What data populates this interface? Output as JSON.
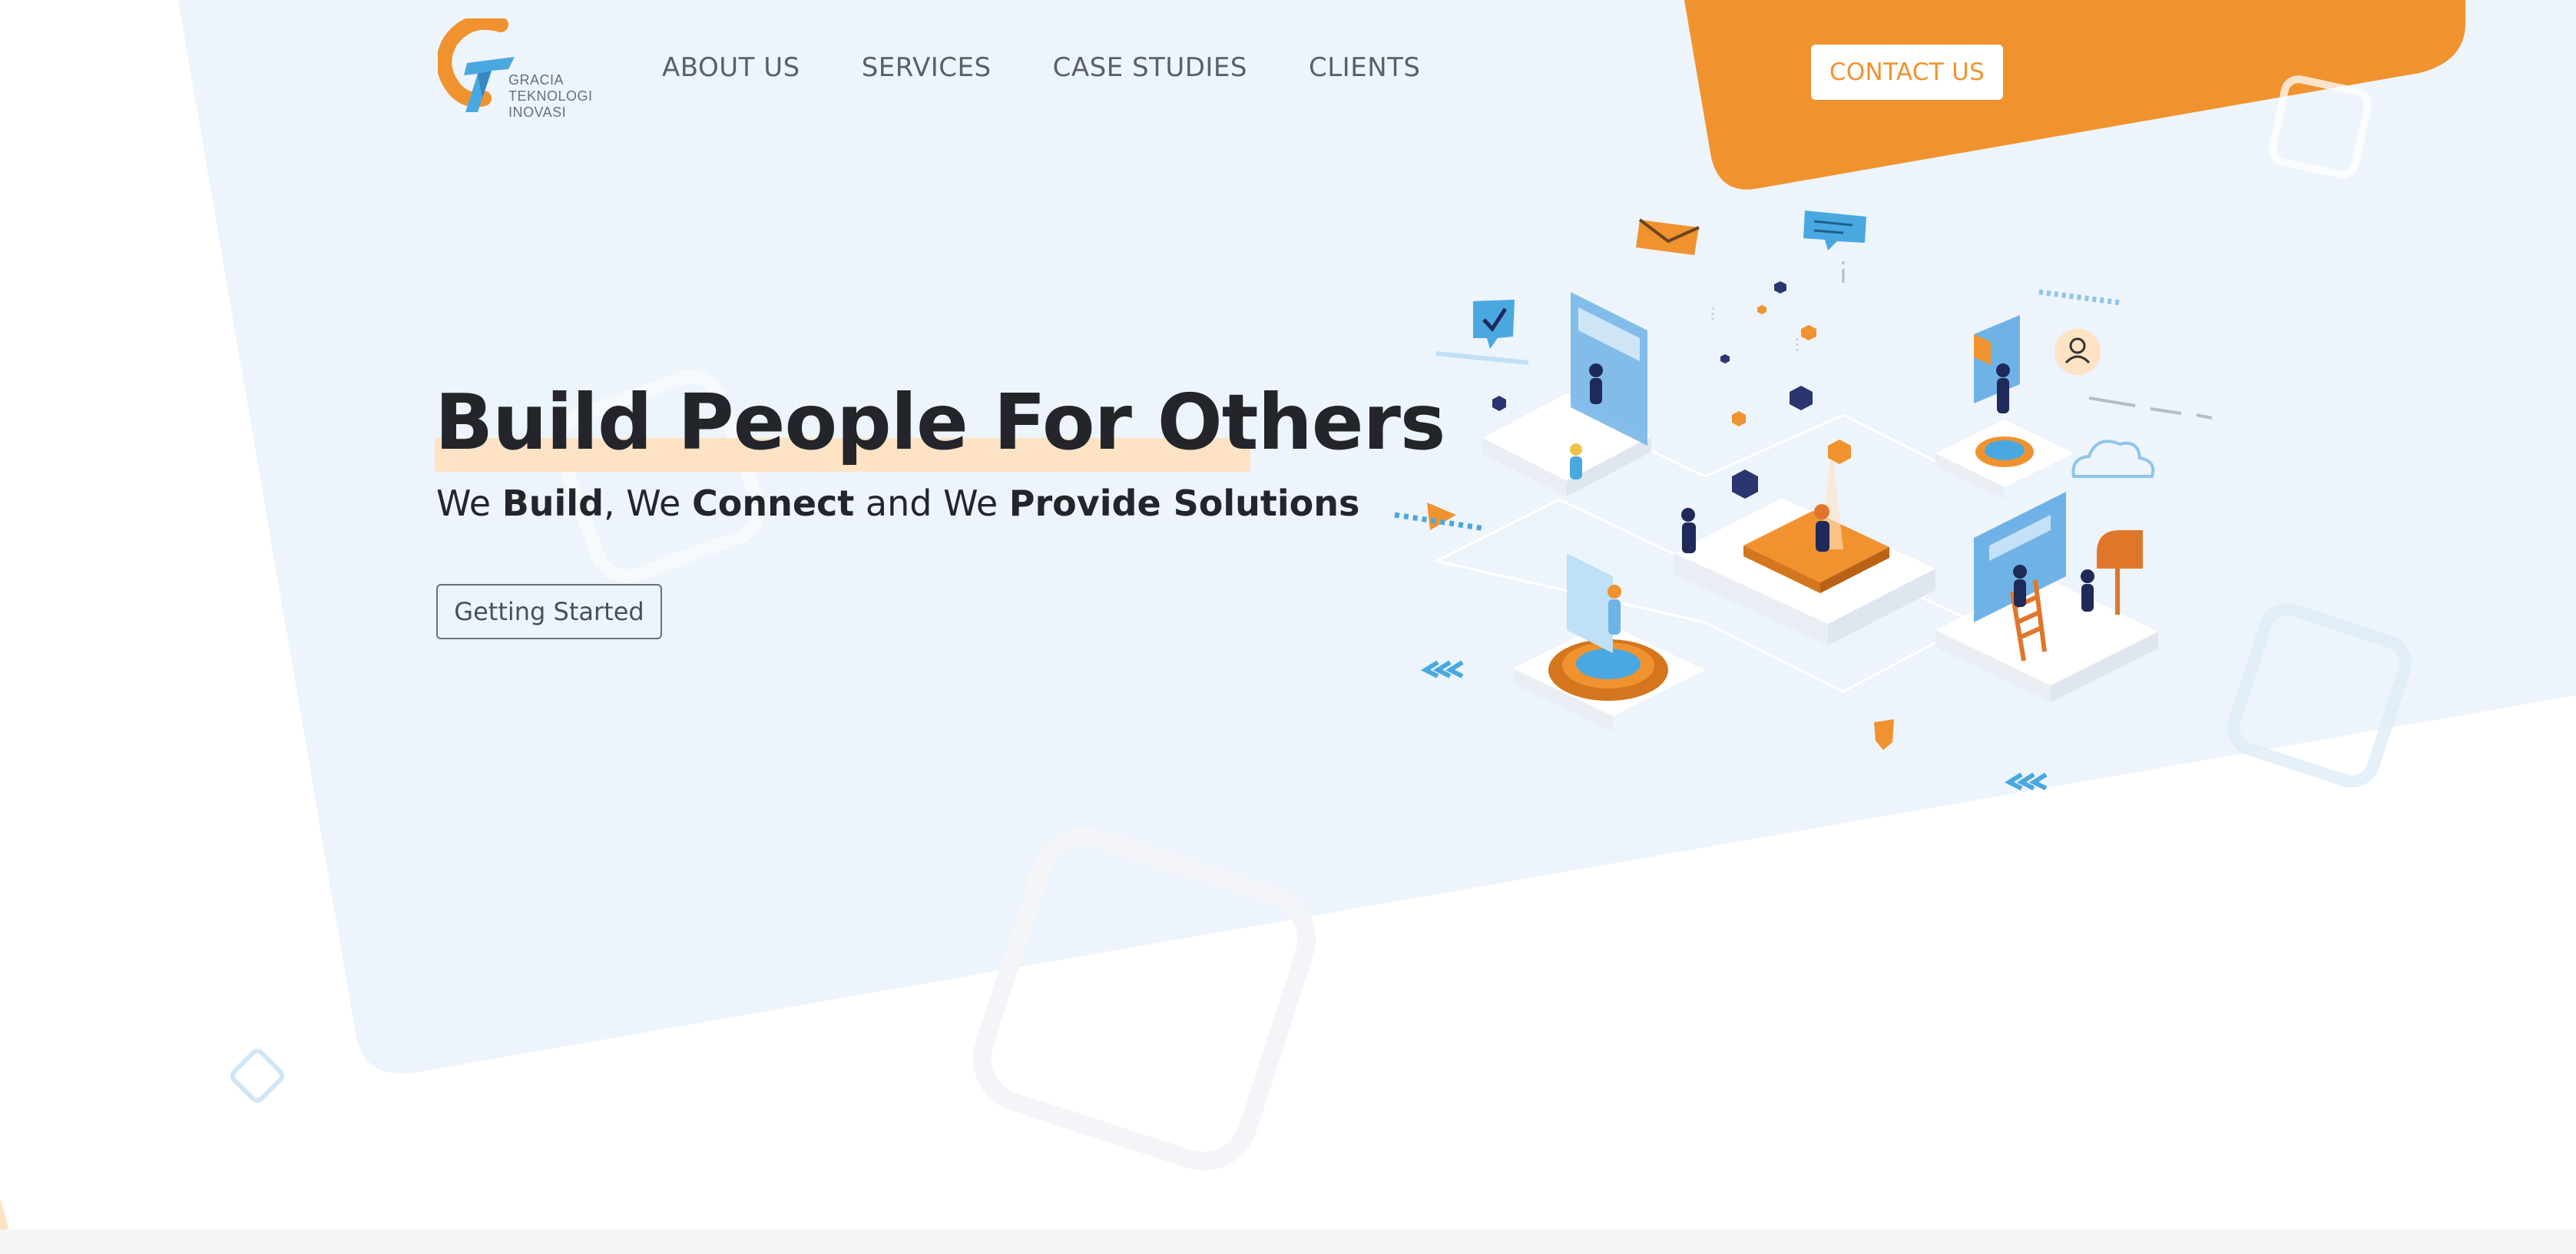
{
  "brand": {
    "logo_lines": [
      "GRACIA",
      "TEKNOLOGI",
      "INOVASI"
    ],
    "logo_letters": "GT",
    "colors": {
      "orange": "#f0932f",
      "blue": "#4aa8e0",
      "bg": "#edf4fb",
      "text": "#23252b"
    }
  },
  "nav": {
    "items": [
      {
        "label": "ABOUT US"
      },
      {
        "label": "SERVICES"
      },
      {
        "label": "CASE STUDIES"
      },
      {
        "label": "CLIENTS"
      }
    ],
    "contact_label": "CONTACT US"
  },
  "hero": {
    "title": "Build People For Others",
    "subtitle": {
      "p1": "We ",
      "b1": "Build",
      "p2": ", We ",
      "b2": "Connect",
      "p3": " and We ",
      "b3": "Provide Solutions"
    },
    "cta_label": "Getting Started"
  },
  "illustration": {
    "icons": [
      "envelope-icon",
      "chat-bubble-icon",
      "check-badge-icon",
      "user-avatar-icon",
      "cloud-icon",
      "play-arrow-icon",
      "chevron-arrows-icon"
    ]
  }
}
